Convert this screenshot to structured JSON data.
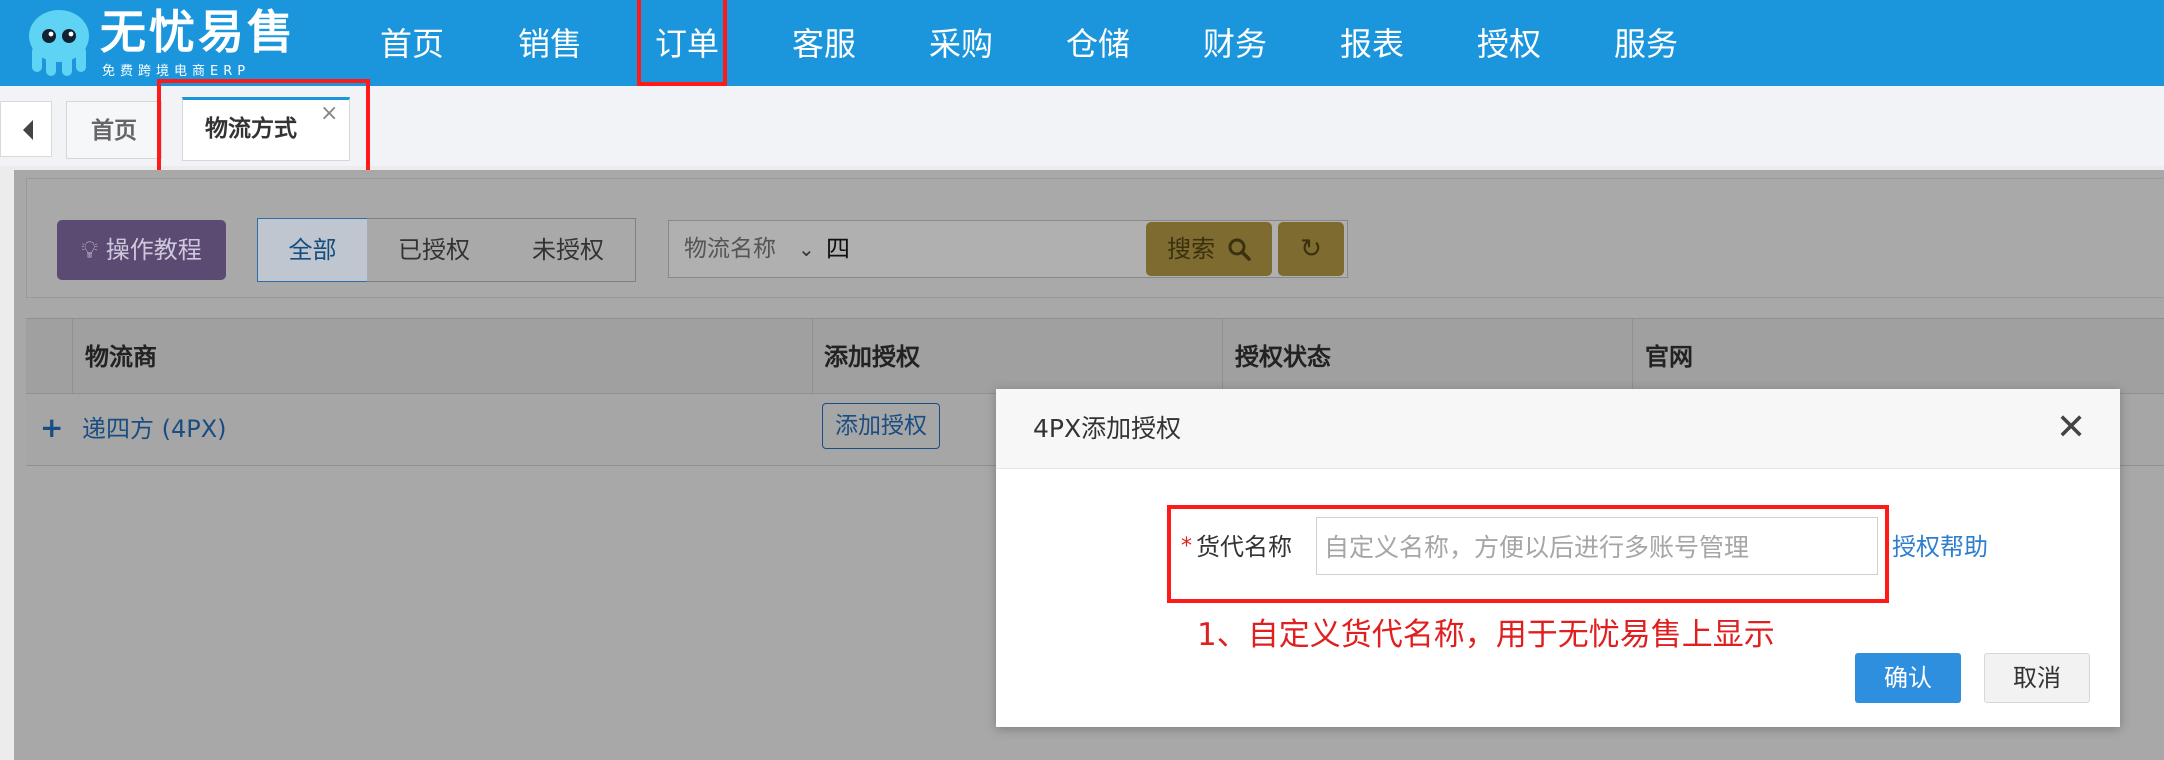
{
  "app": {
    "logo_title": "无忧易售",
    "logo_subtitle": "免费跨境电商ERP"
  },
  "nav": {
    "items": [
      {
        "label": "首页"
      },
      {
        "label": "销售"
      },
      {
        "label": "订单"
      },
      {
        "label": "客服"
      },
      {
        "label": "采购"
      },
      {
        "label": "仓储"
      },
      {
        "label": "财务"
      },
      {
        "label": "报表"
      },
      {
        "label": "授权"
      },
      {
        "label": "服务"
      }
    ],
    "highlighted": "订单"
  },
  "tabs": {
    "items": [
      {
        "label": "首页"
      },
      {
        "label": "物流方式",
        "active": true,
        "close": "×"
      }
    ]
  },
  "toolbar": {
    "tutorial_label": "操作教程",
    "filters": [
      "全部",
      "已授权",
      "未授权"
    ],
    "active_filter": "全部",
    "search_field": "物流名称",
    "search_value": "四",
    "search_label": "搜索"
  },
  "table": {
    "columns": [
      "物流商",
      "添加授权",
      "授权状态",
      "官网"
    ],
    "rows": [
      {
        "expand": "+",
        "name": "递四方 (4PX)",
        "action": "添加授权"
      }
    ]
  },
  "modal": {
    "title": "4PX添加授权",
    "close": "✕",
    "field_required_mark": "*",
    "field_label": "货代名称",
    "field_placeholder": "自定义名称，方便以后进行多账号管理",
    "field_value": "",
    "help_link": "授权帮助",
    "annotation": "1、自定义货代名称，用于无忧易售上显示",
    "confirm_label": "确认",
    "cancel_label": "取消"
  },
  "colors": {
    "nav_bg": "#1b96dc",
    "highlight": "#ff1a1a",
    "primary": "#2f8fdf",
    "link": "#2e7ed0"
  }
}
